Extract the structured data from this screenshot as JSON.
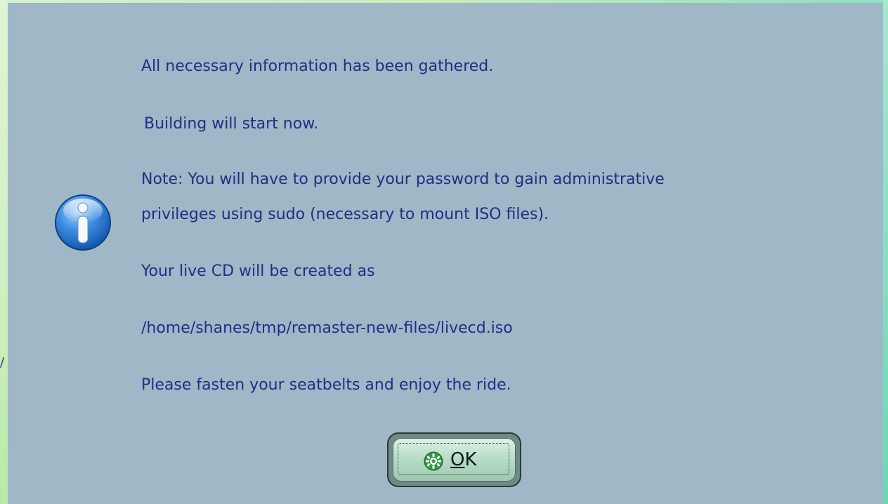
{
  "dialog": {
    "icon": "info-icon",
    "message_lines": [
      "All necessary information has been gathered.",
      "Building will start now.",
      "Note: You will have to provide your password to gain administrative",
      "privileges using sudo (necessary to mount ISO files).",
      "Your live CD will be created as",
      "/home/shanes/tmp/remaster-new-files/livecd.iso",
      "Please fasten your seatbelts and enjoy the ride."
    ],
    "ok_button": {
      "icon": "kde-gear-icon",
      "mnemonic": "O",
      "rest": "K"
    }
  },
  "background": {
    "stray_glyph": "/"
  },
  "colors": {
    "dialog_bg": "#9fb7c6",
    "text": "#1f2f86",
    "button_face": "#b9ddc8"
  }
}
